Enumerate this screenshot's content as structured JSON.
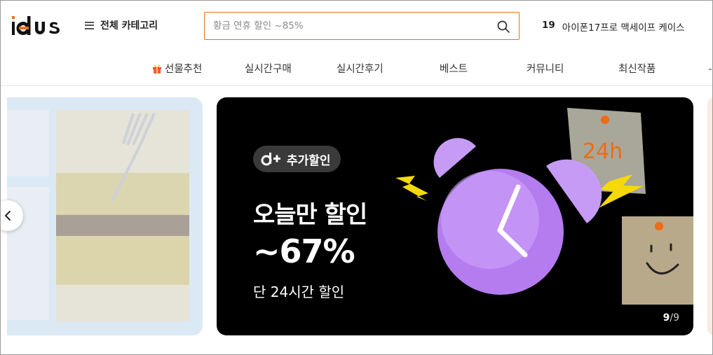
{
  "header": {
    "logo_text": "idus",
    "category_label": "전체 카테고리",
    "search": {
      "placeholder": "황금 연휴 할인 ~85%",
      "value": ""
    },
    "trending": {
      "rank": "19",
      "keyword": "아이폰17프로 맥세이프 케이스"
    }
  },
  "nav": {
    "items": [
      {
        "label": "선물추천",
        "icon": "gift-icon"
      },
      {
        "label": "실시간구매"
      },
      {
        "label": "실시간후기"
      },
      {
        "label": "베스트"
      },
      {
        "label": "커뮤니티"
      },
      {
        "label": "최신작품"
      }
    ]
  },
  "banner": {
    "badge_label": "추가할인",
    "headline": "오늘만 할인",
    "discount": "~67%",
    "subtitle": "단 24시간 할인",
    "note_text": "24h",
    "counter_current": "9",
    "counter_total": "/9"
  },
  "colors": {
    "brand": "#ef7014",
    "banner_bg": "#000000",
    "clock": "#b57cf0",
    "lightning": "#f5d90a"
  },
  "icons": [
    "hamburger-icon",
    "search-icon",
    "gift-icon",
    "chevron-left-icon",
    "alarm-clock-icon",
    "lightning-icon",
    "pushpin-icon",
    "smiley-icon"
  ]
}
